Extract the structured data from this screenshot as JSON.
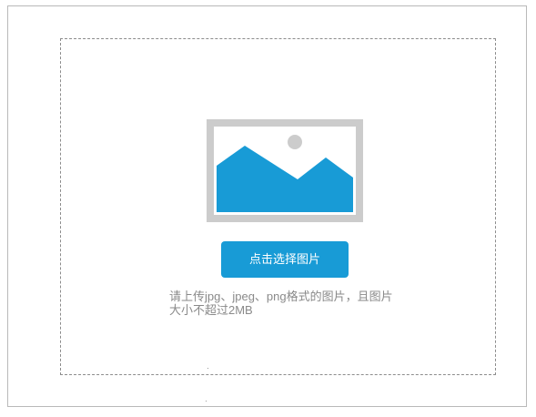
{
  "upload": {
    "button_label": "点击选择图片",
    "hint_line1": "请上传jpg、jpeg、png格式的图片，且图片",
    "hint_line2": "大小不超过2MB"
  },
  "colors": {
    "accent": "#189bd6",
    "placeholder_frame": "#cccccc",
    "hint_text": "#8a8a8a",
    "dashed_border": "#8c8c8c"
  },
  "icons": {
    "placeholder": "image-placeholder-icon"
  }
}
